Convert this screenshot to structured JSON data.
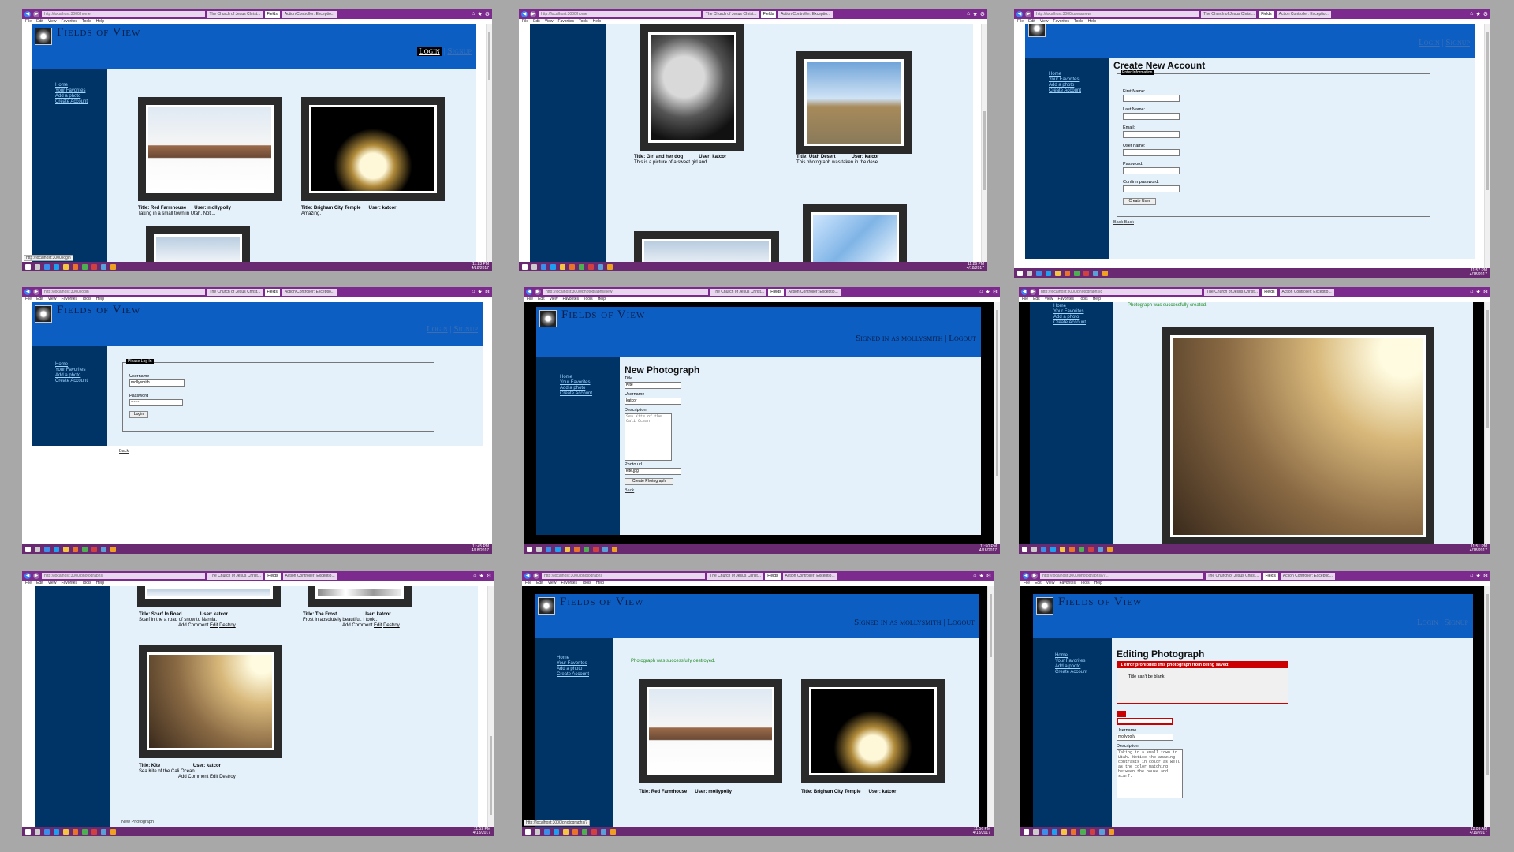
{
  "browser": {
    "tab_church": "The Church of Jesus Christ...",
    "tab_fields": "Fields",
    "tab_action": "Action Controller: Exceptio...",
    "menus": [
      "File",
      "Edit",
      "View",
      "Favorites",
      "Tools",
      "Help"
    ]
  },
  "site": {
    "title": "Fields of View",
    "login": "Login",
    "signup": "Signup",
    "divider": "|",
    "signed_in": "Signed in as mollysmith",
    "logout": "Logout",
    "nav": [
      "Home",
      "Your Favorites",
      "Add a photo",
      "Create Account"
    ]
  },
  "tiles": [
    {
      "url": "http://localhost:3000/home",
      "time": "11:23 PM",
      "date": "4/18/2017",
      "status_url": "http://localhost:3000/login",
      "cards": [
        {
          "title": "Title: Red Farmhouse",
          "user": "User: mollypolly",
          "desc": "Taking in a small town in Utah. Noti..."
        },
        {
          "title": "Title: Brigham City Temple",
          "user": "User: katcor",
          "desc": "Amazing."
        }
      ]
    },
    {
      "url": "http://localhost:3000/home",
      "time": "11:26 PM",
      "date": "4/18/2017",
      "cards": [
        {
          "title": "Title: Girl and her dog",
          "user": "User: katcor",
          "desc": "This is a picture of a sweet girl and..."
        },
        {
          "title": "Title: Utah Desert",
          "user": "User: katcor",
          "desc": "This photograph was taken in the dese..."
        }
      ]
    },
    {
      "url": "http://localhost:3000/users/new",
      "time": "11:57 PM",
      "date": "4/18/2017",
      "heading": "Create New Account",
      "legend": "Enter Information",
      "fields": [
        "First Name:",
        "Last Name:",
        "Email:",
        "User name:",
        "Password:",
        "Confirm password:"
      ],
      "button": "Create User",
      "back": "Back",
      "back2": "Back"
    },
    {
      "url": "http://localhost:3000/login",
      "time": "11:45 PM",
      "date": "4/18/2017",
      "legend": "Please Log In",
      "username_label": "Username",
      "username_value": "mollysmith",
      "password_label": "Password",
      "password_value": "••••••",
      "button": "Login",
      "back": "Back"
    },
    {
      "url": "http://localhost:3000/photographs/new",
      "time": "11:50 PM",
      "date": "4/18/2017",
      "heading": "New Photograph",
      "title_label": "Title",
      "title_value": "Kite",
      "username_label": "Username",
      "username_value": "katcor",
      "description_label": "Description",
      "description_value": "Sea Kite of the Cali Ocean",
      "photo_label": "Photo url",
      "photo_value": "kite.jpg",
      "button": "Create Photograph",
      "back": "Back"
    },
    {
      "url": "http://localhost:3000/photographs/8",
      "time": "11:51 PM",
      "date": "4/18/2017",
      "notice": "Photograph was successfully created."
    },
    {
      "url": "http://localhost:3000/photographs",
      "time": "11:52 PM",
      "date": "4/18/2017",
      "cards": [
        {
          "title": "Title: Scarf In Road",
          "user": "User: katcor",
          "desc": "Scarf in the a road of snow to Narnia."
        },
        {
          "title": "Title: The Frost",
          "user": "User: katcor",
          "desc": "Frost in absolutely beautiful. I took..."
        },
        {
          "title": "Title: Kite",
          "user": "User: katcor",
          "desc": "Sea Kite of the Cali Ocean"
        }
      ],
      "add_comment": "Add Comment",
      "edit": "Edit",
      "destroy": "Destroy",
      "new_photo": "New Photograph"
    },
    {
      "url": "http://localhost:3000/photographs",
      "time": "11:56 PM",
      "date": "4/18/2017",
      "notice": "Photograph was successfully destroyed.",
      "status_url": "http://localhost:3000/photographs/7",
      "cards": [
        {
          "title": "Title: Red Farmhouse",
          "user": "User: mollypolly"
        },
        {
          "title": "Title: Brigham City Temple",
          "user": "User: katcor"
        }
      ]
    },
    {
      "url": "http://localhost:3000/photographs/7/...",
      "time": "12:09 AM",
      "date": "4/19/2017",
      "heading": "Editing Photograph",
      "error_head": "1 error prohibited this photograph from being saved:",
      "error_item": "Title can't be blank",
      "username_label": "Username",
      "username_value": "mollypolly",
      "description_label": "Description",
      "description_value": "Taking in a small town in Utah. Notice the amazing contrasts in color as well as the color matching between the house and scarf."
    }
  ]
}
